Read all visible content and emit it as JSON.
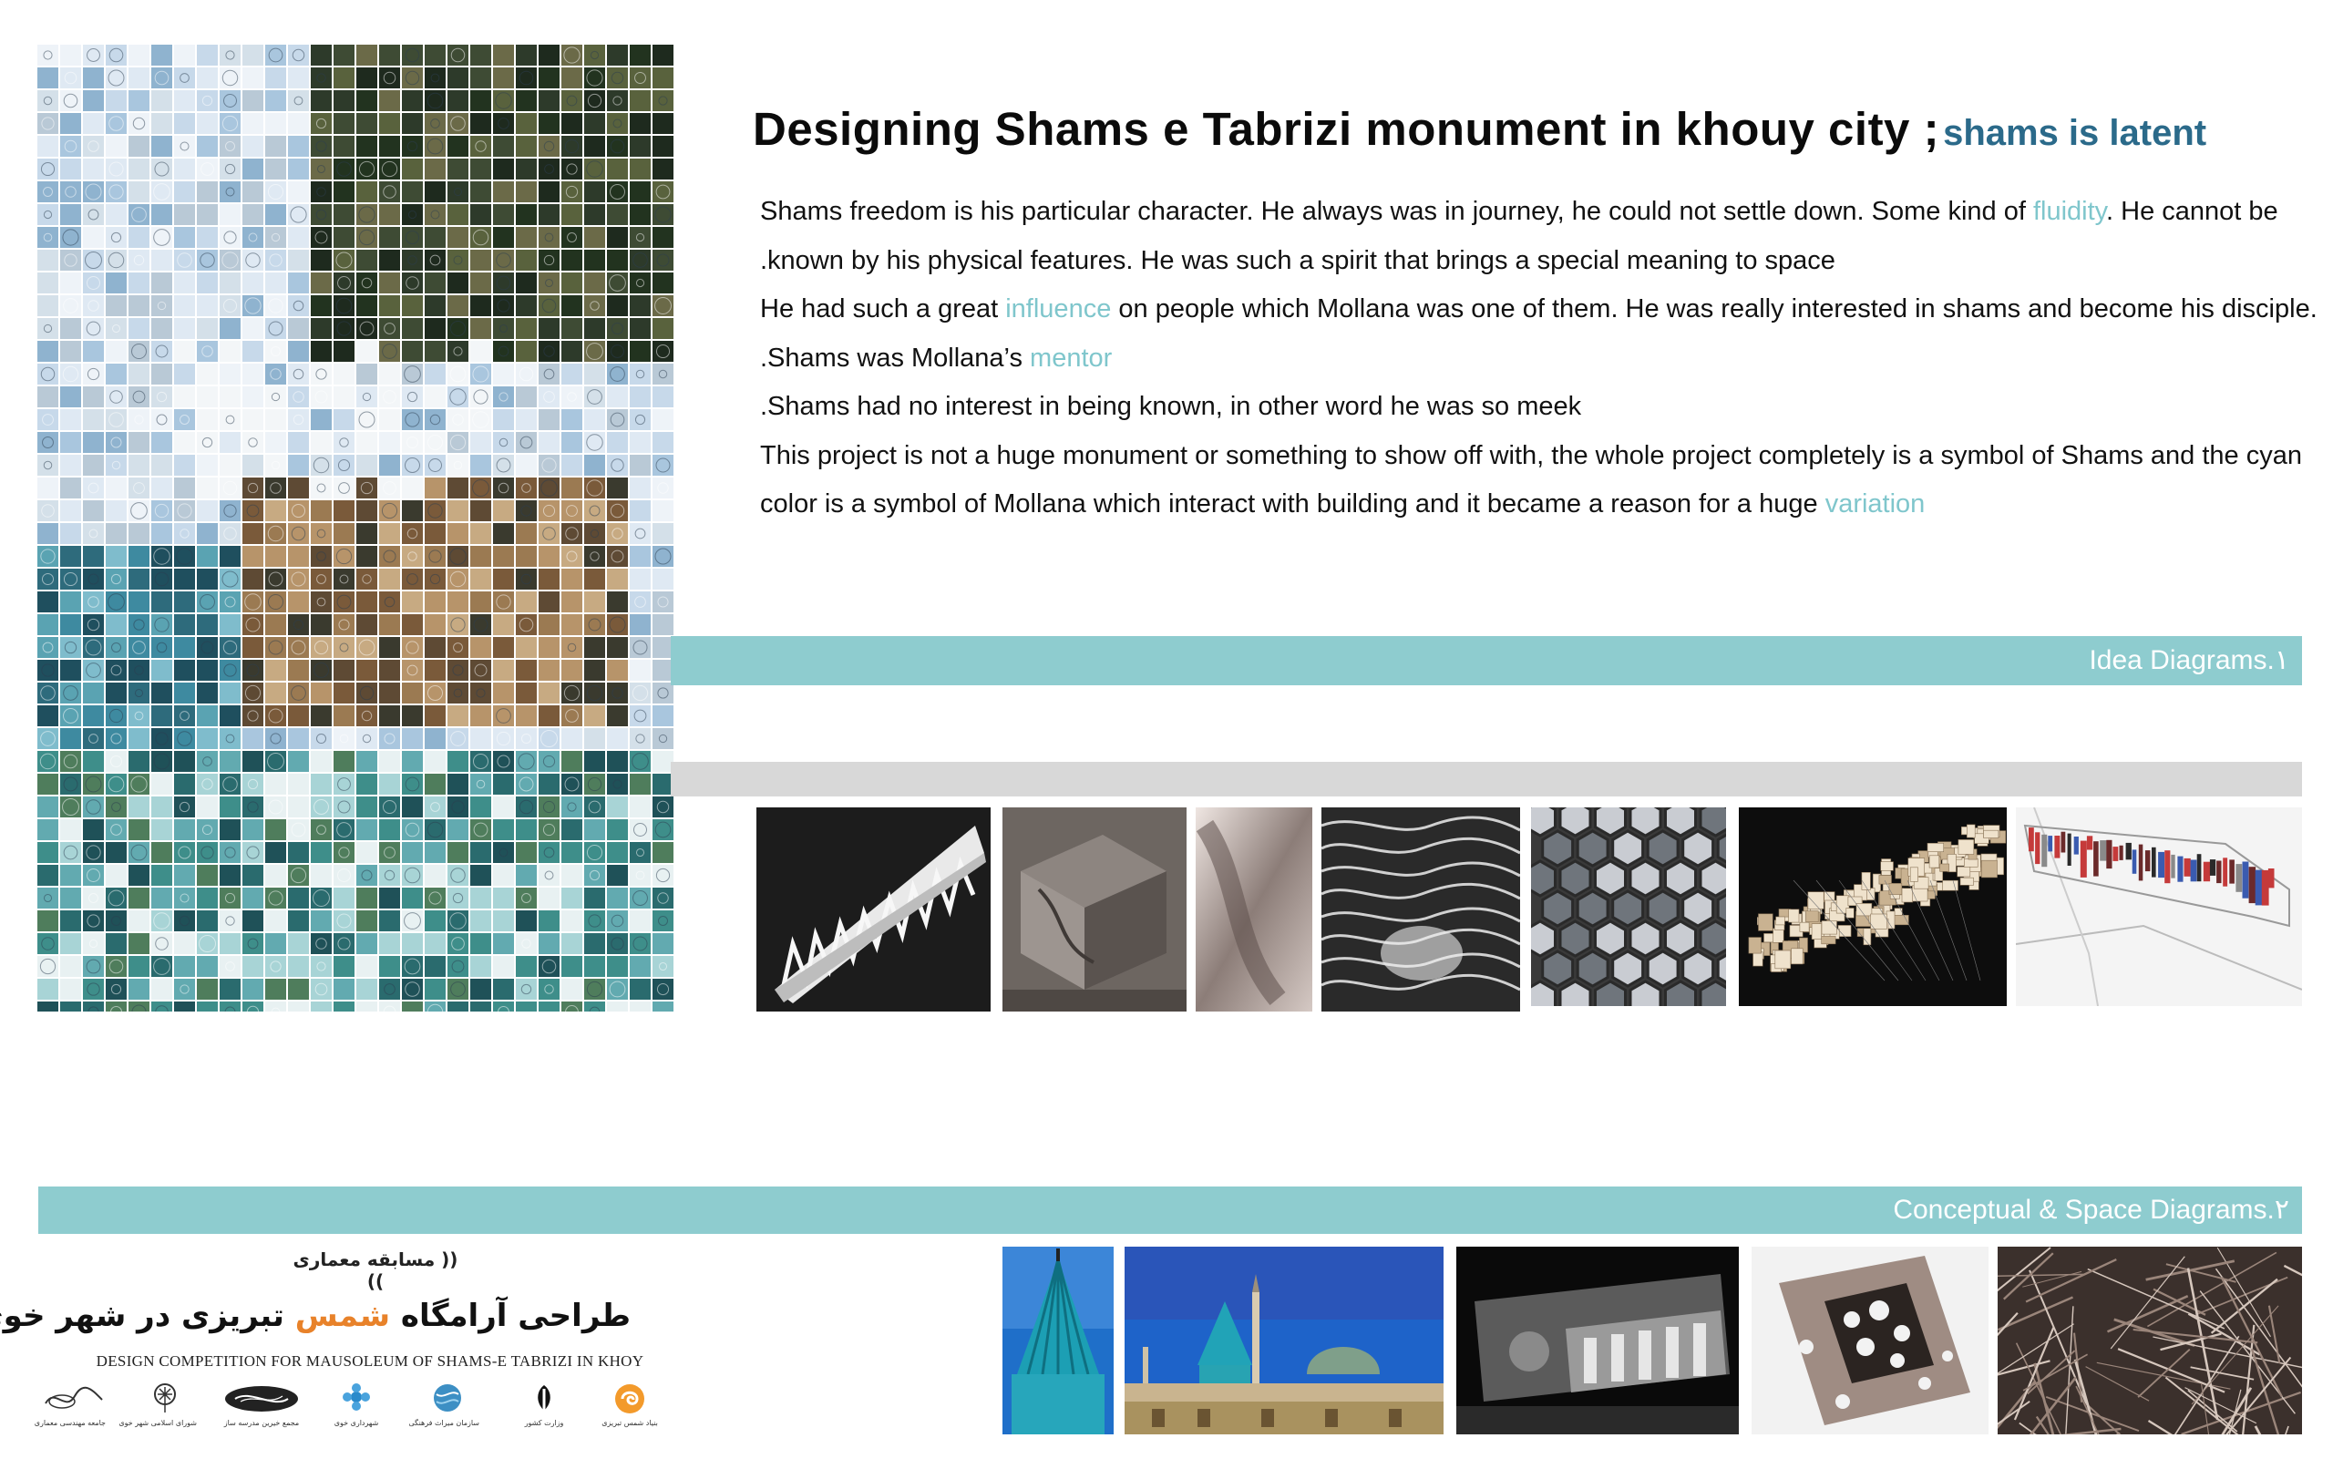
{
  "header": {
    "title": "Designing Shams e Tabrizi monument in khouy city ;",
    "subtitle": "shams is latent"
  },
  "description": {
    "line1_a": "Shams freedom is his particular character. He always was in journey, he could not settle down. Some kind of ",
    "line1_hl": "fluidity",
    "line1_b": ". He cannot be",
    "line2": ".known by his physical features. He was such a spirit that brings a special meaning to space",
    "line3_a": "He had such a great ",
    "line3_hl": "influence",
    "line3_b": " on people which Mollana was one of them. He was really interested in shams and become his disciple.",
    "line4_a": ".Shams was Mollana’s ",
    "line4_hl": "mentor",
    "line5": ".Shams had no interest in being known, in other word he was so meek",
    "line6": "This project is not a huge monument or something to show off with, the whole project completely is a symbol of Shams and the cyan",
    "line7_a": "color is a symbol of Mollana which interact with building and it became a reason for a huge ",
    "line7_hl": "variation"
  },
  "sections": {
    "idea": "Idea Diagrams.۱",
    "conceptual": "Conceptual & Space Diagrams.۲"
  },
  "competition": {
    "label": "(( مسابقه معماری ))",
    "title_fa_a": "طراحی آرامگاه ",
    "title_fa_hl": "شمس",
    "title_fa_b": " تبریزی در شهر خوی",
    "title_en": "DESIGN COMPETITION FOR MAUSOLEUM OF SHAMS-E TABRIZI IN KHOY",
    "logos": [
      {
        "icon": "signature-logo-icon",
        "caption": "جامعه مهندسی معماری"
      },
      {
        "icon": "tree-logo-icon",
        "caption": "شورای اسلامی شهر خوی"
      },
      {
        "icon": "calligraphy-logo-icon",
        "caption": "مجمع خیرین مدرسه ساز"
      },
      {
        "icon": "flower-logo-icon",
        "caption": "شهرداری خوی"
      },
      {
        "icon": "globe-logo-icon",
        "caption": "سازمان میراث فرهنگی"
      },
      {
        "icon": "emblem-logo-icon",
        "caption": "وزارت کشور"
      },
      {
        "icon": "swirl-logo-icon",
        "caption": "بنیاد شمس تبریزی"
      }
    ]
  },
  "colors": {
    "accent_cyan": "#8ecccf",
    "highlight_text": "#7fc6cc",
    "subtitle_blue": "#2b6a8a",
    "accent_orange": "#e8822a"
  }
}
